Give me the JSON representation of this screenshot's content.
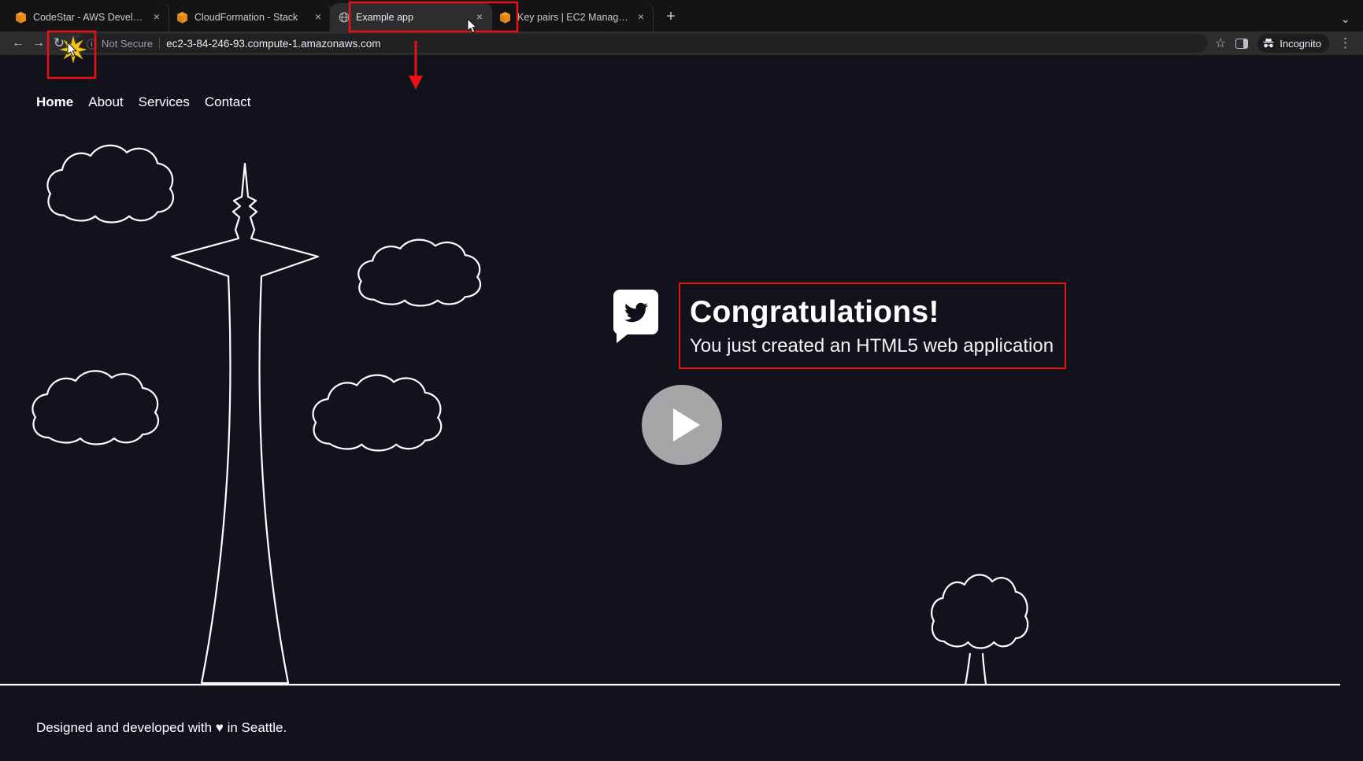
{
  "browser": {
    "tab_strip": {
      "tabs": [
        {
          "label": "CodeStar - AWS Developer To",
          "favicon": "aws-cube-icon",
          "active": false
        },
        {
          "label": "CloudFormation - Stack",
          "favicon": "aws-cube-icon",
          "active": false
        },
        {
          "label": "Example app",
          "favicon": "globe-icon",
          "active": true
        },
        {
          "label": "Key pairs | EC2 Management C",
          "favicon": "aws-cube-icon",
          "active": false
        }
      ],
      "close_icon": "×",
      "new_tab_icon": "+",
      "tab_search_icon": "⌄"
    },
    "toolbar": {
      "back_icon": "←",
      "forward_icon": "→",
      "reload_icon": "↻",
      "security_icon": "ⓘ",
      "security_label": "Not Secure",
      "url": "ec2-3-84-246-93.compute-1.amazonaws.com",
      "bookmark_icon": "☆",
      "incognito_label": "Incognito",
      "menu_icon": "⋮"
    }
  },
  "page": {
    "nav": {
      "items": [
        {
          "label": "Home",
          "active": true
        },
        {
          "label": "About",
          "active": false
        },
        {
          "label": "Services",
          "active": false
        },
        {
          "label": "Contact",
          "active": false
        }
      ]
    },
    "hero": {
      "title": "Congratulations!",
      "subtitle": "You just created an HTML5 web application"
    },
    "footer": {
      "text": "Designed and developed with ♥ in Seattle."
    }
  },
  "colors": {
    "annotation_red": "#e91111",
    "page_background": "#12121d",
    "line_art_white": "#ffffff",
    "aws_orange": "#ef8b12",
    "play_button_gray": "#a6a6a8",
    "starburst_yellow": "#f3c614"
  }
}
